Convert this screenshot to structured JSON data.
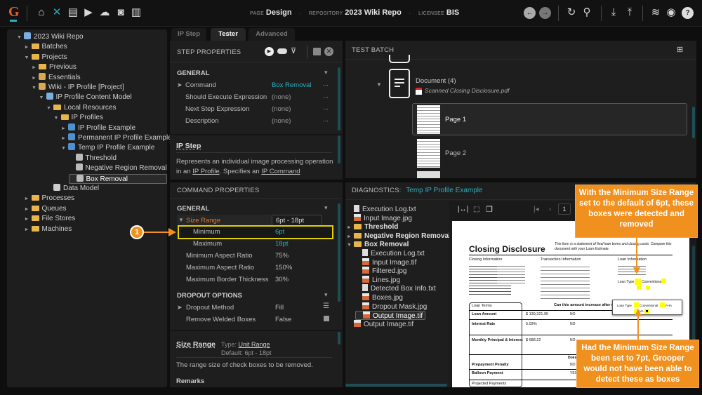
{
  "topbar": {
    "page_label": "PAGE",
    "page": "Design",
    "repo_label": "REPOSITORY",
    "repo": "2023 Wiki Repo",
    "licensee_label": "LICENSEE",
    "licensee": "BIS",
    "icons": [
      "home-icon",
      "tools-icon",
      "archive-icon",
      "video-box-icon",
      "cloud-upload-icon",
      "briefcase-clock-icon",
      "bar-chart-icon"
    ],
    "right_icons": [
      "back-icon",
      "forward-icon",
      "refresh-icon",
      "search-icon",
      "download-icon",
      "upload-icon",
      "database-icon",
      "user-icon",
      "help-icon"
    ]
  },
  "tree": [
    {
      "label": "2023 Wiki Repo",
      "depth": 0,
      "exp": "▼",
      "icon": "repo"
    },
    {
      "label": "Batches",
      "depth": 1,
      "exp": "►",
      "icon": "folder"
    },
    {
      "label": "Projects",
      "depth": 1,
      "exp": "▼",
      "icon": "folder"
    },
    {
      "label": "Previous",
      "depth": 2,
      "exp": "►",
      "icon": "folder"
    },
    {
      "label": "Essentials",
      "depth": 2,
      "exp": "►",
      "icon": "project"
    },
    {
      "label": "Wiki - IP Profile [Project]",
      "depth": 2,
      "exp": "▼",
      "icon": "project"
    },
    {
      "label": "IP Profile Content Model",
      "depth": 3,
      "exp": "▼",
      "icon": "model"
    },
    {
      "label": "Local Resources",
      "depth": 4,
      "exp": "▼",
      "icon": "folder"
    },
    {
      "label": "IP Profiles",
      "depth": 5,
      "exp": "▼",
      "icon": "folder"
    },
    {
      "label": "IP Profile Example",
      "depth": 6,
      "exp": "►",
      "icon": "profile"
    },
    {
      "label": "Permanent IP Profile Example",
      "depth": 6,
      "exp": "►",
      "icon": "profile"
    },
    {
      "label": "Temp IP Profile Example",
      "depth": 6,
      "exp": "▼",
      "icon": "profile"
    },
    {
      "label": "Threshold",
      "depth": 7,
      "exp": "",
      "icon": "step"
    },
    {
      "label": "Negative Region Removal",
      "depth": 7,
      "exp": "",
      "icon": "step"
    },
    {
      "label": "Box Removal",
      "depth": 7,
      "exp": "",
      "icon": "step",
      "selected": true
    },
    {
      "label": "Data Model",
      "depth": 4,
      "exp": "",
      "icon": "datamodel"
    },
    {
      "label": "Processes",
      "depth": 1,
      "exp": "►",
      "icon": "folder"
    },
    {
      "label": "Queues",
      "depth": 1,
      "exp": "►",
      "icon": "folder"
    },
    {
      "label": "File Stores",
      "depth": 1,
      "exp": "►",
      "icon": "folder"
    },
    {
      "label": "Machines",
      "depth": 1,
      "exp": "►",
      "icon": "folder"
    }
  ],
  "tabs": [
    "IP Step",
    "Tester",
    "Advanced"
  ],
  "active_tab": "Tester",
  "step_props": {
    "title": "STEP PROPERTIES",
    "section": "GENERAL",
    "rows": [
      {
        "name": "Command",
        "value": "Box Removal",
        "accent": true,
        "exp": "➤"
      },
      {
        "name": "Should Execute Expression",
        "value": "(none)"
      },
      {
        "name": "Next Step Expression",
        "value": "(none)"
      },
      {
        "name": "Description",
        "value": "(none)"
      }
    ],
    "more": "..."
  },
  "help1": {
    "title": "IP Step",
    "text_a": "Represents an individual image processing operation in an ",
    "link1": "IP Profile",
    "text_b": ". Specifies an ",
    "link2": "IP Command"
  },
  "cmd_props": {
    "title": "COMMAND PROPERTIES",
    "section": "GENERAL",
    "size_range": {
      "name": "Size Range",
      "value": "6pt - 18pt"
    },
    "min": {
      "name": "Minimum",
      "value": "6pt"
    },
    "max": {
      "name": "Maximum",
      "value": "18pt"
    },
    "rows": [
      {
        "name": "Minimum Aspect Ratio",
        "value": "75%"
      },
      {
        "name": "Maximum Aspect Ratio",
        "value": "150%"
      },
      {
        "name": "Maximum Border Thickness",
        "value": "30%"
      }
    ],
    "section2": "DROPOUT OPTIONS",
    "rows2": [
      {
        "name": "Dropout Method",
        "value": "Fill"
      },
      {
        "name": "Remove Welded Boxes",
        "value": "False"
      }
    ]
  },
  "help2": {
    "title": "Size Range",
    "type_label": "Type:",
    "type": "Unit Range",
    "default": "Default: 6pt - 18pt",
    "desc": "The range size of check boxes to be removed.",
    "remarks": "Remarks"
  },
  "test_batch": {
    "title": "TEST BATCH",
    "doc": "Document (4)",
    "file": "Scanned Closing Disclosure.pdf",
    "pages": [
      "Page 1",
      "Page 2"
    ]
  },
  "diagnostics": {
    "label": "DIAGNOSTICS:",
    "name": "Temp IP Profile Example",
    "files": [
      {
        "label": "Execution Log.txt",
        "depth": 0,
        "icon": "txt"
      },
      {
        "label": "Input Image.jpg",
        "depth": 0,
        "icon": "img"
      },
      {
        "label": "Threshold",
        "depth": 0,
        "icon": "folder",
        "exp": "►",
        "bold": true
      },
      {
        "label": "Negative Region Removal",
        "depth": 0,
        "icon": "folder",
        "exp": "►",
        "bold": true
      },
      {
        "label": "Box Removal",
        "depth": 0,
        "icon": "folder",
        "exp": "▼",
        "bold": true
      },
      {
        "label": "Execution Log.txt",
        "depth": 1,
        "icon": "txt"
      },
      {
        "label": "Input Image.tif",
        "depth": 1,
        "icon": "img"
      },
      {
        "label": "Filtered.jpg",
        "depth": 1,
        "icon": "img"
      },
      {
        "label": "Lines.jpg",
        "depth": 1,
        "icon": "img"
      },
      {
        "label": "Detected Box Info.txt",
        "depth": 1,
        "icon": "txt"
      },
      {
        "label": "Boxes.jpg",
        "depth": 1,
        "icon": "img"
      },
      {
        "label": "Dropout Mask.jpg",
        "depth": 1,
        "icon": "img"
      },
      {
        "label": "Output Image.tif",
        "depth": 1,
        "icon": "img",
        "selected": true
      },
      {
        "label": "Output Image.tif",
        "depth": 0,
        "icon": "img"
      }
    ],
    "page_num": "1"
  },
  "document": {
    "title": "Closing Disclosure",
    "intro": "This form is a statement of final loan terms and closing costs. Compare this document with your Loan Estimate.",
    "col1": "Closing Information",
    "col2": "Transaction Information",
    "col3": "Loan Information",
    "loan_type": "Loan Type",
    "conventional": "Conventional",
    "fha": "FHA",
    "va": "VA",
    "loan_terms": "Loan Terms",
    "can_increase": "Can this amount increase after closing?",
    "rows": [
      {
        "name": "Loan Amount",
        "value": "$ 139,321.95",
        "ans": "NO"
      },
      {
        "name": "Interest Rate",
        "value": "5.03%",
        "ans": "NO"
      },
      {
        "name": "Monthly Principal & Interest",
        "value": "$ 688.22",
        "ans": "NO"
      }
    ],
    "prepay": "Prepayment Penalty",
    "balloon": "Balloon Payment",
    "prepay_ans": "NO",
    "balloon_ans": "YES",
    "projected": "Projected Payments",
    "does": "Does"
  },
  "callouts": {
    "badge": "1",
    "top": "With the Minimum Size Range set to the default of 6pt, these boxes were detected and removed",
    "bottom": "Had the Minimum Size Range been set to 7pt, Grooper would not have been able to detect these as boxes"
  },
  "colors": {
    "accent": "#28b0c0",
    "highlight": "#f0901e",
    "selection": "#e0d000",
    "orange_text": "#e07a2a"
  }
}
